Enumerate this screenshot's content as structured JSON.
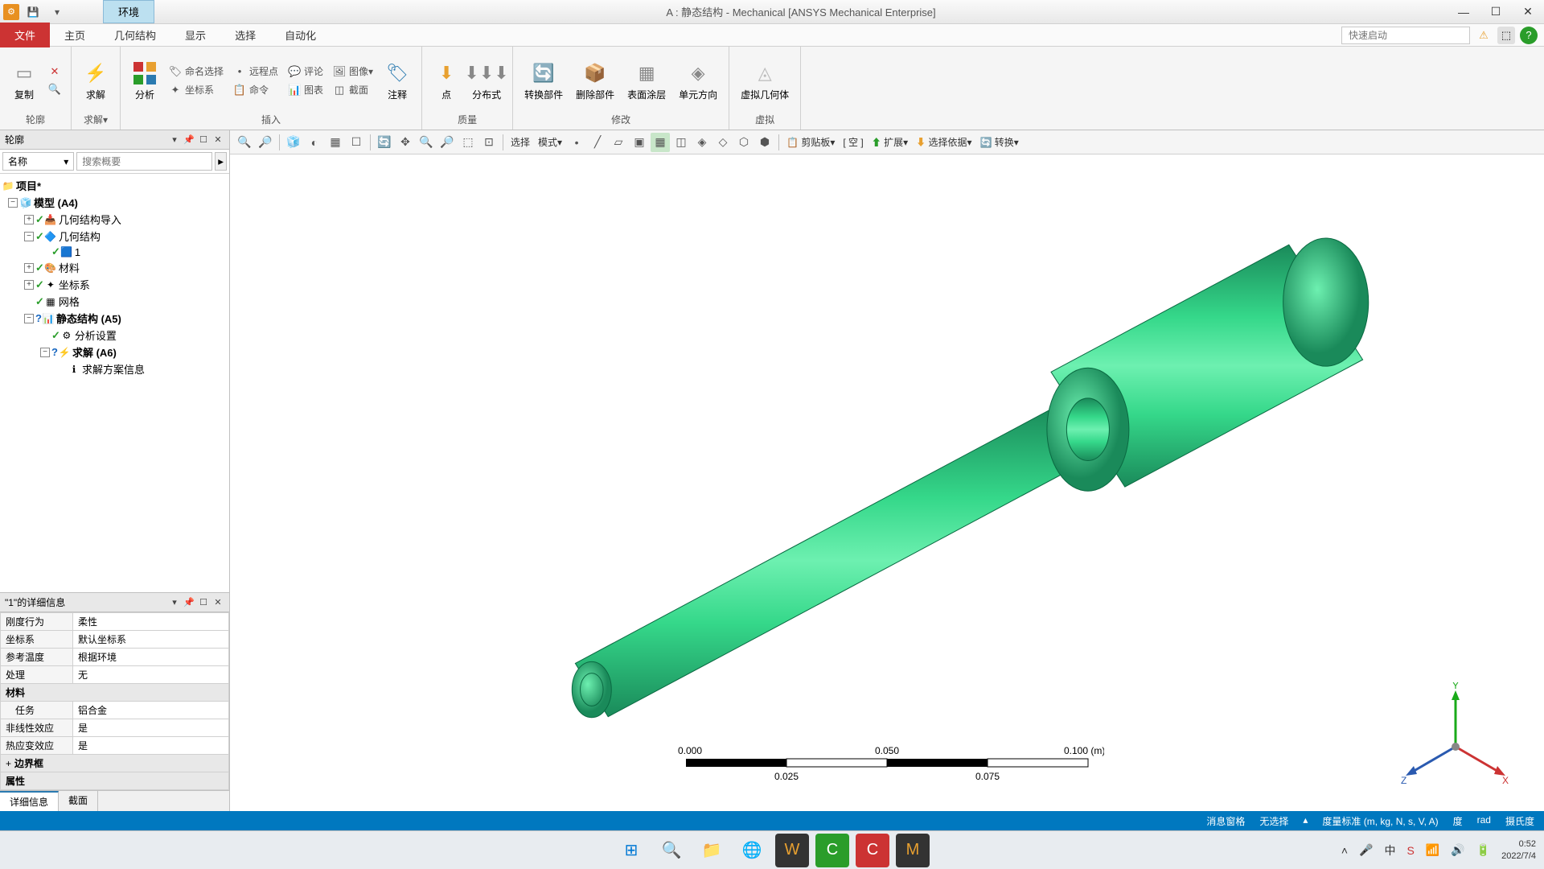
{
  "titlebar": {
    "env_tab": "环境",
    "title": "A : 静态结构 - Mechanical [ANSYS Mechanical Enterprise]"
  },
  "ribbon_tabs": {
    "file": "文件",
    "home": "主页",
    "geometry": "几何结构",
    "display": "显示",
    "selection": "选择",
    "automation": "自动化"
  },
  "quick_launch_placeholder": "快速启动",
  "ribbon": {
    "duplicate": "复制",
    "outline_group": "轮廓",
    "solve": "求解",
    "solve_dd": "求解▾",
    "analysis": "分析",
    "named_sel": "命名选择",
    "remote_pt": "远程点",
    "coord_sys": "坐标系",
    "comment": "评论",
    "command": "命令",
    "chart": "图表",
    "image": "图像▾",
    "section": "截面",
    "annotation": "注释",
    "insert_group": "插入",
    "point": "点",
    "distributed": "分布式",
    "mass_group": "质量",
    "replace_part": "转换部件",
    "delete_part": "删除部件",
    "surface_coating": "表面涂层",
    "elem_orient": "单元方向",
    "modify_group": "修改",
    "virtual_body": "虚拟几何体",
    "virtual_group": "虚拟"
  },
  "outline_panel": {
    "title": "轮廓",
    "filter_name": "名称",
    "filter_placeholder": "搜索概要"
  },
  "tree": {
    "project": "项目*",
    "model": "模型 (A4)",
    "geom_import": "几何结构导入",
    "geometry": "几何结构",
    "body1": "1",
    "materials": "材料",
    "coord_sys": "坐标系",
    "mesh": "网格",
    "static": "静态结构 (A5)",
    "analysis_settings": "分析设置",
    "solution": "求解 (A6)",
    "solution_info": "求解方案信息"
  },
  "details_panel": {
    "title": "\"1\"的详细信息"
  },
  "details_rows": {
    "stiffness_behavior": "刚度行为",
    "stiffness_val": "柔性",
    "coord_sys": "坐标系",
    "coord_sys_val": "默认坐标系",
    "ref_temp": "参考温度",
    "ref_temp_val": "根据环境",
    "treatment": "处理",
    "treatment_val": "无",
    "material_cat": "材料",
    "assignment": "任务",
    "assignment_val": "铝合金",
    "nonlinear": "非线性效应",
    "nonlinear_val": "是",
    "thermal": "热应变效应",
    "thermal_val": "是",
    "bbox_cat": "边界框",
    "props_cat": "属性"
  },
  "bottom_tabs": {
    "details": "详细信息",
    "section": "截面"
  },
  "view_toolbar": {
    "select": "选择",
    "mode": "模式▾",
    "clipboard": "剪贴板▾",
    "empty": "[ 空 ]",
    "extend": "扩展▾",
    "select_by": "选择依据▾",
    "convert": "转换▾"
  },
  "scale": {
    "t0": "0.000",
    "t1": "0.050",
    "t2": "0.100 (m)",
    "b0": "0.025",
    "b1": "0.075"
  },
  "status": {
    "msg_win": "消息窗格",
    "no_sel": "无选择",
    "units": "度量标准 (m, kg, N, s, V, A)",
    "deg": "度",
    "rad": "rad",
    "celsius": "摄氏度"
  },
  "tray": {
    "time": "0:52",
    "date": "2022/7/4"
  }
}
